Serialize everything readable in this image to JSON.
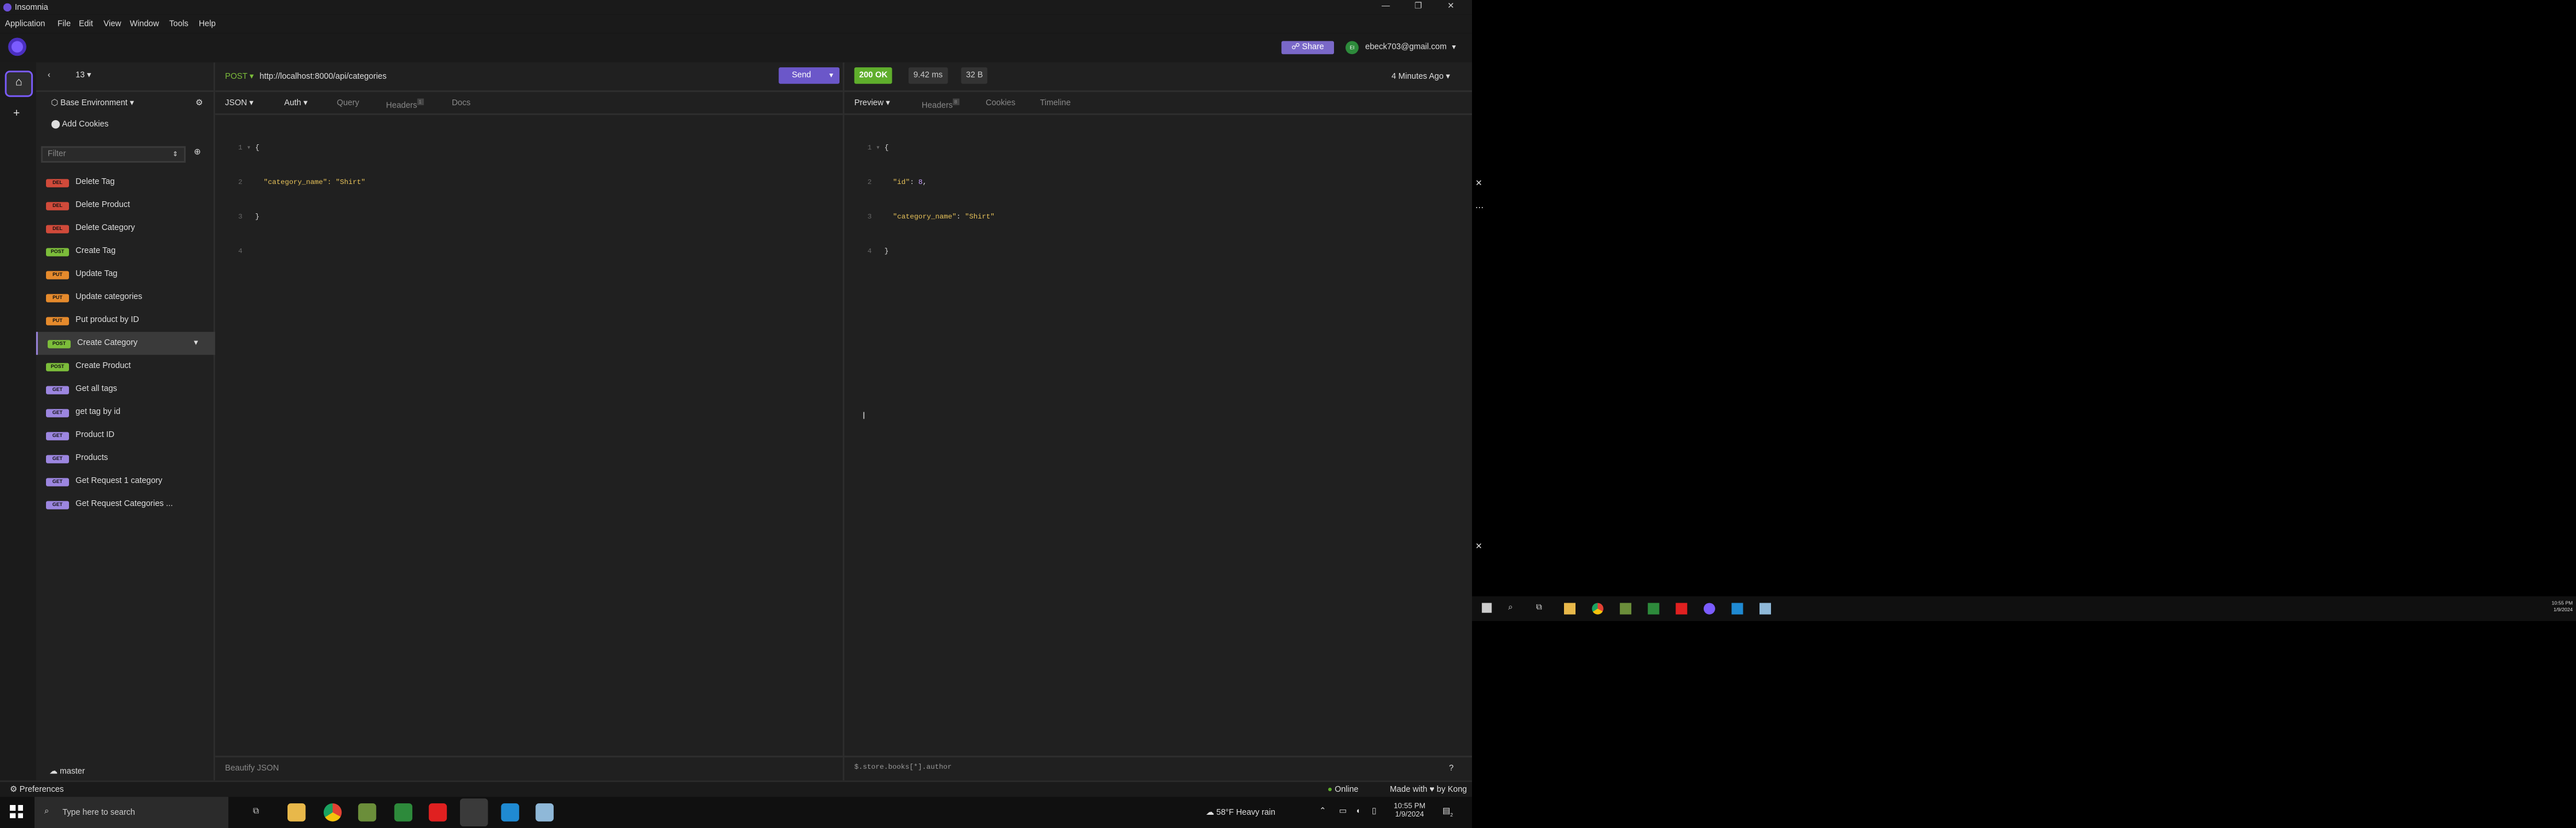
{
  "window": {
    "title": "Insomnia"
  },
  "menu": [
    "Application",
    "File",
    "Edit",
    "View",
    "Window",
    "Tools",
    "Help"
  ],
  "header": {
    "share_label": "Share",
    "user_initials": "EI",
    "user_email": "ebeck703@gmail.com"
  },
  "sidebar": {
    "project_label": "13",
    "environment_label": "Base Environment",
    "cookies_label": "Add Cookies",
    "filter_placeholder": "Filter",
    "items": [
      {
        "method": "DEL",
        "label": "Delete Tag"
      },
      {
        "method": "DEL",
        "label": "Delete Product"
      },
      {
        "method": "DEL",
        "label": "Delete Category"
      },
      {
        "method": "POST",
        "label": "Create Tag"
      },
      {
        "method": "PUT",
        "label": "Update Tag"
      },
      {
        "method": "PUT",
        "label": "Update categories"
      },
      {
        "method": "PUT",
        "label": "Put product by ID"
      },
      {
        "method": "POST",
        "label": "Create Category"
      },
      {
        "method": "POST",
        "label": "Create Product"
      },
      {
        "method": "GET",
        "label": "Get all tags"
      },
      {
        "method": "GET",
        "label": "get tag by id"
      },
      {
        "method": "GET",
        "label": "Product ID"
      },
      {
        "method": "GET",
        "label": "Products"
      },
      {
        "method": "GET",
        "label": "Get Request 1 category"
      },
      {
        "method": "GET",
        "label": "Get Request Categories ..."
      }
    ],
    "git_branch": "master"
  },
  "request": {
    "method": "POST",
    "url": "http://localhost:8000/api/categories",
    "send_label": "Send",
    "tabs": {
      "body": "JSON",
      "auth": "Auth",
      "query": "Query",
      "headers": "Headers",
      "headers_count": "1",
      "docs": "Docs"
    },
    "body_lines": [
      "{",
      "  \"category_name\": \"Shirt\"",
      "}",
      ""
    ],
    "footer": "Beautify JSON"
  },
  "response": {
    "status": "200 OK",
    "time": "9.42 ms",
    "size": "32 B",
    "age": "4 Minutes Ago",
    "tabs": {
      "preview": "Preview",
      "headers": "Headers",
      "headers_count": "8",
      "cookies": "Cookies",
      "timeline": "Timeline"
    },
    "body": {
      "id_key": "\"id\"",
      "id_val": "8",
      "name_key": "\"category_name\"",
      "name_val": "\"Shirt\""
    },
    "filter_text": "$.store.books[*].author"
  },
  "status": {
    "preferences_label": "Preferences",
    "online_label": "Online",
    "made_with": "Made with ♥ by Kong"
  },
  "taskbar": {
    "search_placeholder": "Type here to search",
    "weather": "58°F  Heavy rain",
    "time": "10:55 PM",
    "date": "1/9/2024",
    "second_time": "10:55 PM",
    "second_date": "1/9/2024",
    "notification_count": "2"
  },
  "colors": {
    "accent": "#9c86e0",
    "status_ok": "#5fae2c",
    "del": "#d04a3a",
    "post": "#7cbd3a",
    "put": "#e58a2c",
    "get": "#9c86e0"
  }
}
